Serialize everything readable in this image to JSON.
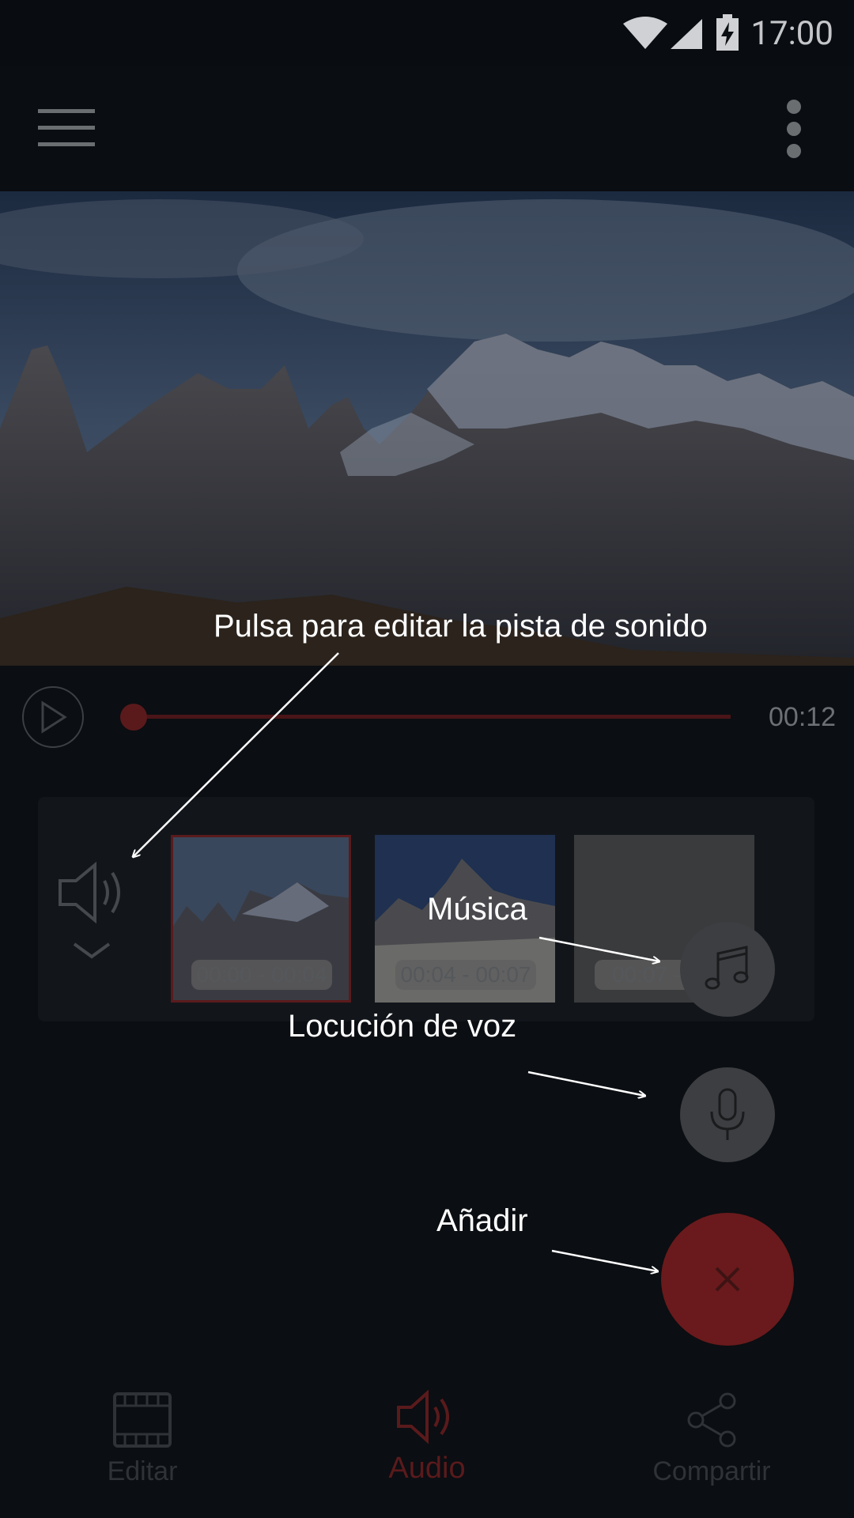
{
  "status_bar": {
    "time": "17:00",
    "icons": [
      "wifi-icon",
      "signal-icon",
      "battery-charging-icon"
    ]
  },
  "app_bar": {
    "icons": [
      "menu-icon",
      "more-vert-icon"
    ]
  },
  "player": {
    "elapsed_time": "00:12",
    "progress": 0.0
  },
  "timeline": {
    "clips": [
      {
        "label": "00:00 - 00:04",
        "selected": true
      },
      {
        "label": "00:04 - 00:07",
        "selected": false
      },
      {
        "label": "00:07 - 00:",
        "selected": false
      }
    ]
  },
  "annotations": {
    "sound_track": "Pulsa para editar la pista de sonido",
    "music": "Música",
    "voice": "Locución de voz",
    "add": "Añadir"
  },
  "bottom_nav": {
    "items": [
      {
        "label": "Editar",
        "icon": "film-icon",
        "active": false
      },
      {
        "label": "Audio",
        "icon": "speaker-icon",
        "active": true
      },
      {
        "label": "Compartir",
        "icon": "share-icon",
        "active": false
      }
    ]
  },
  "colors": {
    "accent": "#c0282a",
    "accent_dim": "#6a1a1c",
    "background": "#0b0e12"
  }
}
